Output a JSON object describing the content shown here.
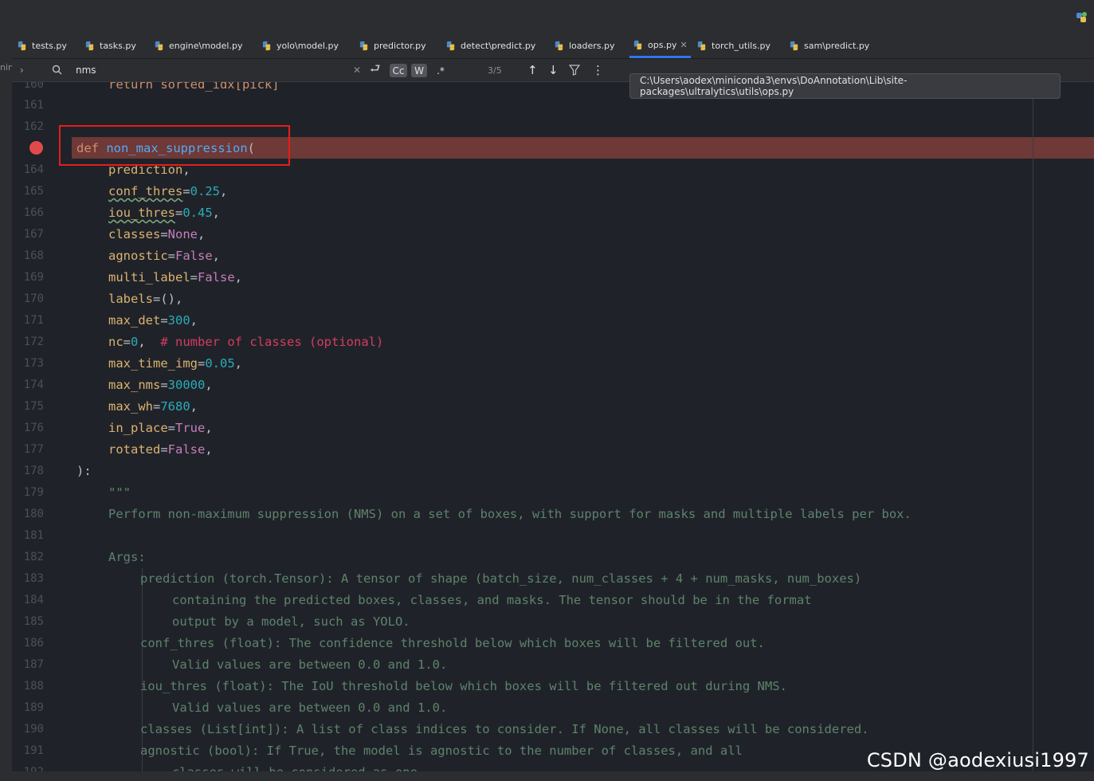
{
  "tabs": [
    {
      "label": "tests.py"
    },
    {
      "label": "tasks.py"
    },
    {
      "label": "engine\\model.py"
    },
    {
      "label": "yolo\\model.py"
    },
    {
      "label": "predictor.py"
    },
    {
      "label": "detect\\predict.py"
    },
    {
      "label": "loaders.py"
    },
    {
      "label": "ops.py",
      "active": true
    },
    {
      "label": "torch_utils.py"
    },
    {
      "label": "sam\\predict.py"
    }
  ],
  "left_strip": {
    "label": "nin"
  },
  "find": {
    "query": "nms",
    "match_case": "Cc",
    "words": "W",
    "regex": ".*",
    "count": "3/5"
  },
  "tooltip": "C:\\Users\\aodex\\miniconda3\\envs\\DoAnnotation\\Lib\\site-packages\\ultralytics\\utils\\ops.py",
  "editor": {
    "line_numbers": [
      "160",
      "161",
      "162",
      "",
      "164",
      "165",
      "166",
      "167",
      "168",
      "169",
      "170",
      "171",
      "172",
      "173",
      "174",
      "175",
      "176",
      "177",
      "178",
      "179",
      "180",
      "181",
      "182",
      "183",
      "184",
      "185",
      "186",
      "187",
      "188",
      "189",
      "190",
      "191",
      "192"
    ],
    "partial_top": "return sorted_idx[pick]",
    "def_kw": "def",
    "func_name": "non_max_suppression",
    "open_paren": "(",
    "params": [
      {
        "name": "prediction",
        "rest": ","
      },
      {
        "name": "conf_thres",
        "eq": "=",
        "val": "0.25",
        "rest": ","
      },
      {
        "name": "iou_thres",
        "eq": "=",
        "val": "0.45",
        "rest": ","
      },
      {
        "name": "classes",
        "eq": "=",
        "val": "None",
        "rest": ","
      },
      {
        "name": "agnostic",
        "eq": "=",
        "val": "False",
        "rest": ","
      },
      {
        "name": "multi_label",
        "eq": "=",
        "val": "False",
        "rest": ","
      },
      {
        "name": "labels",
        "eq": "=",
        "val": "()",
        "rest": ","
      },
      {
        "name": "max_det",
        "eq": "=",
        "val": "300",
        "rest": ","
      },
      {
        "name": "nc",
        "eq": "=",
        "val": "0",
        "rest": ",  "
      },
      {
        "name": "max_time_img",
        "eq": "=",
        "val": "0.05",
        "rest": ","
      },
      {
        "name": "max_nms",
        "eq": "=",
        "val": "30000",
        "rest": ","
      },
      {
        "name": "max_wh",
        "eq": "=",
        "val": "7680",
        "rest": ","
      },
      {
        "name": "in_place",
        "eq": "=",
        "val": "True",
        "rest": ","
      },
      {
        "name": "rotated",
        "eq": "=",
        "val": "False",
        "rest": ","
      }
    ],
    "nc_comment": "# number of classes (optional)",
    "close": "):",
    "doc_open": "\"\"\"",
    "doc_summary": "Perform non-maximum suppression (NMS) on a set of boxes, with support for masks and multiple labels per box.",
    "args_header": "Args:",
    "doc_lines": [
      "prediction (torch.Tensor): A tensor of shape (batch_size, num_classes + 4 + num_masks, num_boxes)",
      "containing the predicted boxes, classes, and masks. The tensor should be in the format",
      "output by a model, such as YOLO.",
      "conf_thres (float): The confidence threshold below which boxes will be filtered out.",
      "Valid values are between 0.0 and 1.0.",
      "iou_thres (float): The IoU threshold below which boxes will be filtered out during NMS.",
      "Valid values are between 0.0 and 1.0.",
      "classes (List[int]): A list of class indices to consider. If None, all classes will be considered.",
      "agnostic (bool): If True, the model is agnostic to the number of classes, and all",
      "classes will be considered as one."
    ]
  },
  "watermark": "CSDN @aodexiusi1997",
  "colors": {
    "keyword": "#cf8e6d",
    "function": "#56a8f5",
    "param": "#dcb270",
    "number": "#2aacb8",
    "builtin": "#c77dbb",
    "comment": "#d53c5e",
    "breakpoint_line": "#6e3936",
    "breakpoint_dot": "#e14a4a",
    "highlight_box": "#e81c1c",
    "active_tab": "#3574f0"
  }
}
